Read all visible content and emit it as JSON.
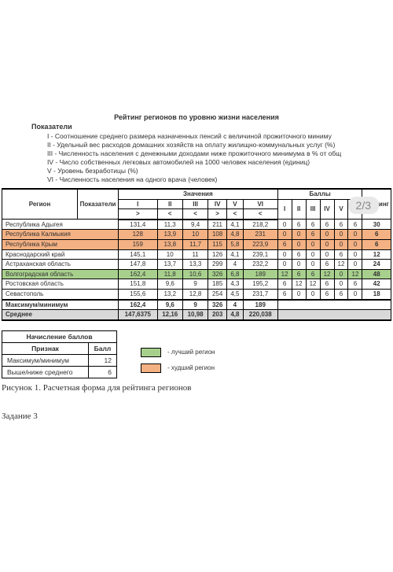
{
  "pager": "2/3",
  "title": "Рейтинг регионов по уровню жизни населения",
  "subhead": "Показатели",
  "indicators": [
    "I -   Соотношение среднего размера назначенных пенсий с величиной прожиточного миниму",
    "II -  Удельный вес расходов домашних хозяйств на оплату жилищно-коммунальных услуг  (%)",
    "III - Численность населения с денежными доходами ниже прожиточного минимума в % от общ",
    "IV -  Число собственных легковых автомобилей на 1000 человек населения (единиц)",
    "V -   Уровень безработицы  (%)",
    "VI -  Численность населения на одного врача (человек)"
  ],
  "table_headers": {
    "region": "Регион",
    "pokaz": "Показатели",
    "values": "Значения",
    "scores": "Баллы",
    "rating": "Рейтинг",
    "roman": [
      "I",
      "II",
      "III",
      "IV",
      "V",
      "VI"
    ],
    "signs": [
      ">",
      "<",
      "<",
      ">",
      "<",
      "<"
    ]
  },
  "rows": [
    {
      "name": "Республика Адыгея",
      "vals": [
        "131,4",
        "11,3",
        "9,4",
        "211",
        "4,1",
        "218,2"
      ],
      "pts": [
        "0",
        "6",
        "6",
        "6",
        "6",
        "6"
      ],
      "rating": "30",
      "cls": ""
    },
    {
      "name": "Республика Калмыкия",
      "vals": [
        "128",
        "13,9",
        "10",
        "108",
        "4,8",
        "231"
      ],
      "pts": [
        "0",
        "0",
        "6",
        "0",
        "0",
        "0"
      ],
      "rating": "6",
      "cls": "row-orange"
    },
    {
      "name": "Республика Крым",
      "vals": [
        "159",
        "13,8",
        "11,7",
        "115",
        "5,8",
        "223,9"
      ],
      "pts": [
        "6",
        "0",
        "0",
        "0",
        "0",
        "0"
      ],
      "rating": "6",
      "cls": "row-orange"
    },
    {
      "name": "Краснодарский край",
      "vals": [
        "145,1",
        "10",
        "11",
        "126",
        "4,1",
        "239,1"
      ],
      "pts": [
        "0",
        "6",
        "0",
        "0",
        "6",
        "0"
      ],
      "rating": "12",
      "cls": ""
    },
    {
      "name": "Астраханская область",
      "vals": [
        "147,8",
        "13,7",
        "13,3",
        "299",
        "4",
        "232,2"
      ],
      "pts": [
        "0",
        "0",
        "0",
        "6",
        "12",
        "0"
      ],
      "rating": "24",
      "cls": ""
    },
    {
      "name": "Волгоградская область",
      "vals": [
        "162,4",
        "11,8",
        "10,6",
        "326",
        "6,8",
        "189"
      ],
      "pts": [
        "12",
        "6",
        "6",
        "12",
        "0",
        "12"
      ],
      "rating": "48",
      "cls": "row-green"
    },
    {
      "name": "Ростовская область",
      "vals": [
        "151,8",
        "9,6",
        "9",
        "185",
        "4,3",
        "195,2"
      ],
      "pts": [
        "6",
        "12",
        "12",
        "6",
        "0",
        "6"
      ],
      "rating": "42",
      "cls": ""
    },
    {
      "name": "Севастополь",
      "vals": [
        "155,6",
        "13,2",
        "12,8",
        "254",
        "4,5",
        "231,7"
      ],
      "pts": [
        "6",
        "0",
        "0",
        "6",
        "6",
        "0"
      ],
      "rating": "18",
      "cls": ""
    }
  ],
  "maxmin": {
    "name": "Максимум/минимум",
    "vals": [
      "162,4",
      "9,6",
      "9",
      "326",
      "4",
      "189"
    ]
  },
  "avg": {
    "name": "Среднее",
    "vals": [
      "147,6375",
      "12,16",
      "10,98",
      "203",
      "4,8",
      "220,038"
    ]
  },
  "score_section": {
    "title": "Начисление баллов",
    "header": [
      "Признак",
      "Балл"
    ],
    "rows": [
      [
        "Максимум/минимум",
        "12"
      ],
      [
        "Выше/ниже среднего",
        "6"
      ]
    ]
  },
  "legend": {
    "best": "- лучший регион",
    "worst": "- худший регион"
  },
  "caption": "Рисунок 1. Расчетная форма для рейтинга регионов",
  "task": "Задание 3"
}
